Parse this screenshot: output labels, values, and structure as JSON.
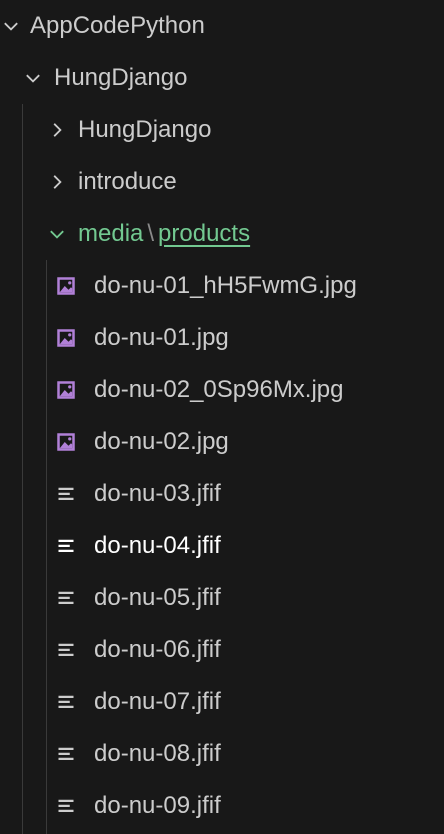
{
  "explorer": {
    "root": {
      "label": "AppCodePython",
      "expanded": true
    },
    "project": {
      "label": "HungDjango",
      "expanded": true
    },
    "folders": [
      {
        "label": "HungDjango",
        "expanded": false
      },
      {
        "label": "introduce",
        "expanded": false
      }
    ],
    "media": {
      "prefix": "media",
      "separator": "\\",
      "suffix": "products",
      "expanded": true,
      "color": "#73c991"
    },
    "files": [
      {
        "label": "do-nu-01_hH5FwmG.jpg",
        "icon": "image-icon"
      },
      {
        "label": "do-nu-01.jpg",
        "icon": "image-icon"
      },
      {
        "label": "do-nu-02_0Sp96Mx.jpg",
        "icon": "image-icon"
      },
      {
        "label": "do-nu-02.jpg",
        "icon": "image-icon"
      },
      {
        "label": "do-nu-03.jfif",
        "icon": "lines-icon"
      },
      {
        "label": "do-nu-04.jfif",
        "icon": "lines-icon",
        "active": true
      },
      {
        "label": "do-nu-05.jfif",
        "icon": "lines-icon"
      },
      {
        "label": "do-nu-06.jfif",
        "icon": "lines-icon"
      },
      {
        "label": "do-nu-07.jfif",
        "icon": "lines-icon"
      },
      {
        "label": "do-nu-08.jfif",
        "icon": "lines-icon"
      },
      {
        "label": "do-nu-09.jfif",
        "icon": "lines-icon"
      }
    ]
  },
  "colors": {
    "background": "#181818",
    "text": "#cccccc",
    "active_text": "#ffffff",
    "image_icon": "#b180d7",
    "accent": "#73c991"
  }
}
